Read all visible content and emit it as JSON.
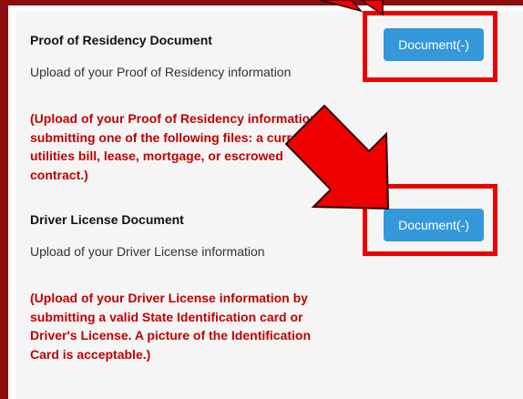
{
  "sections": [
    {
      "title": "Proof of Residency Document",
      "description": "Upload of your Proof of Residency information",
      "note": "(Upload of your Proof of Residency information by submitting one of the following files: a current utilities bill, lease, mortgage, or escrowed contract.)",
      "button_label": "Document(-)"
    },
    {
      "title": "Driver License Document",
      "description": "Upload of your Driver License information",
      "note": "(Upload of your Driver License information by submitting a valid State Identification card or Driver's License. A picture of the Identification Card is acceptable.)",
      "button_label": "Document(-)"
    }
  ],
  "colors": {
    "frame": "#8b0d0d",
    "note_text": "#c00000",
    "button": "#3498db",
    "annotation": "#ee0000"
  },
  "annotations": {
    "icons": [
      "arrow-down-icon",
      "arrow-down-right-icon"
    ]
  }
}
